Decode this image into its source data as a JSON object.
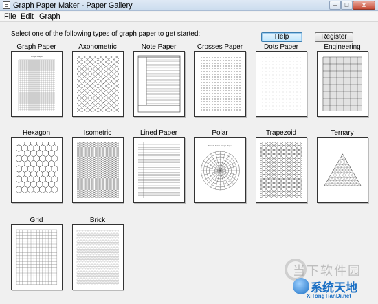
{
  "window": {
    "title": "Graph Paper Maker - Paper Gallery",
    "min_glyph": "‒",
    "max_glyph": "□",
    "close_glyph": "x"
  },
  "menu": [
    "File",
    "Edit",
    "Graph"
  ],
  "instruction": "Select one of the following types of graph paper to get started:",
  "buttons": {
    "help": "Help",
    "register": "Register"
  },
  "papers": [
    {
      "label": "Graph Paper",
      "pattern": "graph",
      "caption": "Graph Paper"
    },
    {
      "label": "Axonometric",
      "pattern": "axonometric"
    },
    {
      "label": "Note Paper",
      "pattern": "note"
    },
    {
      "label": "Crosses Paper",
      "pattern": "crosses"
    },
    {
      "label": "Dots Paper",
      "pattern": "dots"
    },
    {
      "label": "Engineering",
      "pattern": "engineering"
    },
    {
      "label": "Hexagon",
      "pattern": "hexagon"
    },
    {
      "label": "Isometric",
      "pattern": "isometric"
    },
    {
      "label": "Lined Paper",
      "pattern": "lined"
    },
    {
      "label": "Polar",
      "pattern": "polar",
      "caption": "Simple Polar Graph Paper"
    },
    {
      "label": "Trapezoid",
      "pattern": "trapezoid"
    },
    {
      "label": "Ternary",
      "pattern": "ternary"
    },
    {
      "label": "Grid",
      "pattern": "grid"
    },
    {
      "label": "Brick",
      "pattern": "brick"
    }
  ],
  "watermark": {
    "top": "当下软件园",
    "brand": "系统天地",
    "url": "XiTongTianDi.net"
  }
}
